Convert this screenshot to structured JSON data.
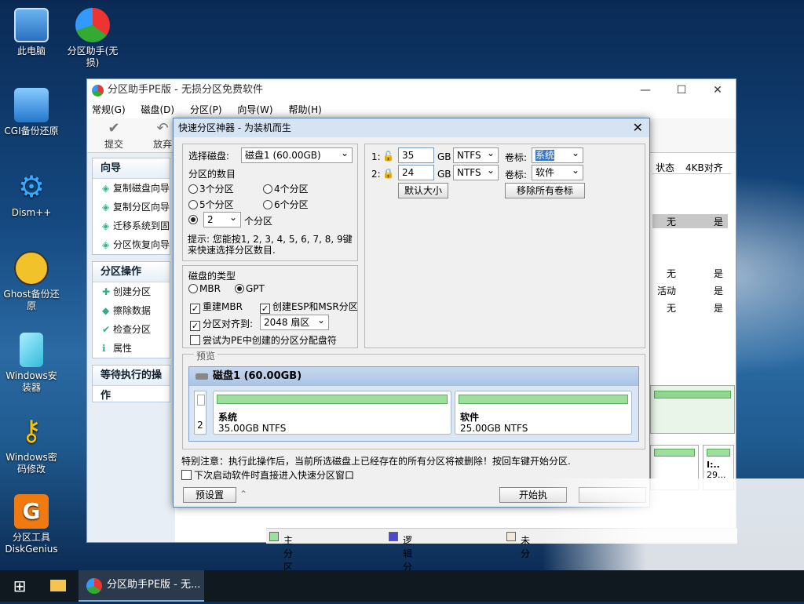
{
  "desktop": {
    "icons": [
      {
        "label": "此电脑",
        "icon": "computer-icon"
      },
      {
        "label": "分区助手(无损)",
        "icon": "partition-assistant-icon"
      },
      {
        "label": "CGI备份还原",
        "icon": "cgi-backup-icon"
      },
      {
        "label": "Dism++",
        "icon": "gear-icon"
      },
      {
        "label": "Ghost备份还原",
        "icon": "ghost-icon"
      },
      {
        "label": "Windows安装器",
        "icon": "windows-installer-icon"
      },
      {
        "label": "Windows密码修改",
        "icon": "key-icon"
      },
      {
        "label": "分区工具DiskGenius",
        "icon": "diskgenius-icon"
      }
    ]
  },
  "taskbar": {
    "app_label": "分区助手PE版 - 无..."
  },
  "main": {
    "title": "分区助手PE版 - 无损分区免费软件",
    "menu": [
      "常规(G)",
      "磁盘(D)",
      "分区(P)",
      "向导(W)",
      "帮助(H)"
    ],
    "toolbar": {
      "commit": "提交",
      "discard": "放弃"
    },
    "wizard": {
      "title": "向导",
      "items": [
        "复制磁盘向导",
        "复制分区向导",
        "迁移系统到固",
        "分区恢复向导"
      ]
    },
    "ops": {
      "title": "分区操作",
      "items": [
        "创建分区",
        "擦除数据",
        "检查分区",
        "属性"
      ]
    },
    "pending": {
      "title": "等待执行的操作"
    },
    "columns": {
      "status": "状态",
      "align4k": "4KB对齐"
    },
    "rows": [
      {
        "status": "无",
        "align": "是"
      },
      {
        "status": "无",
        "align": "是"
      },
      {
        "status": "活动",
        "align": "是"
      },
      {
        "status": "无",
        "align": "是"
      }
    ],
    "disk2": {
      "label": "I:..",
      "size": "29..."
    },
    "legend": {
      "primary": "主分区",
      "logical": "逻辑分区",
      "unalloc": "未分"
    }
  },
  "dialog": {
    "title": "快速分区神器 - 为装机而生",
    "select_disk_label": "选择磁盘:",
    "select_disk_value": "磁盘1 (60.00GB)",
    "count_label": "分区的数目",
    "opt3": "3个分区",
    "opt4": "4个分区",
    "opt5": "5个分区",
    "opt6": "6个分区",
    "custom_count": "2",
    "custom_suffix": "个分区",
    "hint": "提示: 您能按1, 2, 3, 4, 5, 6, 7, 8, 9键来快速选择分区数目.",
    "disk_type_label": "磁盘的类型",
    "mbr": "MBR",
    "gpt": "GPT",
    "rebuild_mbr": "重建MBR",
    "create_esp": "创建ESP和MSR分区",
    "align_label": "分区对齐到:",
    "align_value": "2048 扇区",
    "try_alloc": "尝试为PE中创建的分区分配盘符",
    "parts": [
      {
        "idx": "1:",
        "size": "35",
        "unit": "GB",
        "fs": "NTFS",
        "vol_label": "卷标:",
        "vol": "系统"
      },
      {
        "idx": "2:",
        "size": "24",
        "unit": "GB",
        "fs": "NTFS",
        "vol_label": "卷标:",
        "vol": "软件"
      }
    ],
    "default_size": "默认大小",
    "remove_labels": "移除所有卷标",
    "preview_label": "预览",
    "preview": {
      "disk": "磁盘1 (60.00GB)",
      "idx": "2",
      "p1_name": "系统",
      "p1_size": "35.00GB NTFS",
      "p2_name": "软件",
      "p2_size": "25.00GB NTFS"
    },
    "warning": "特别注意：执行此操作后，当前所选磁盘上已经存在的所有分区将被删除！按回车键开始分区.",
    "direct_enter": "下次启动软件时直接进入快速分区窗口",
    "preset": "预设置",
    "start": "开始执"
  },
  "colors": {
    "accent": "#d5e3f2",
    "green": "#9de09d"
  }
}
